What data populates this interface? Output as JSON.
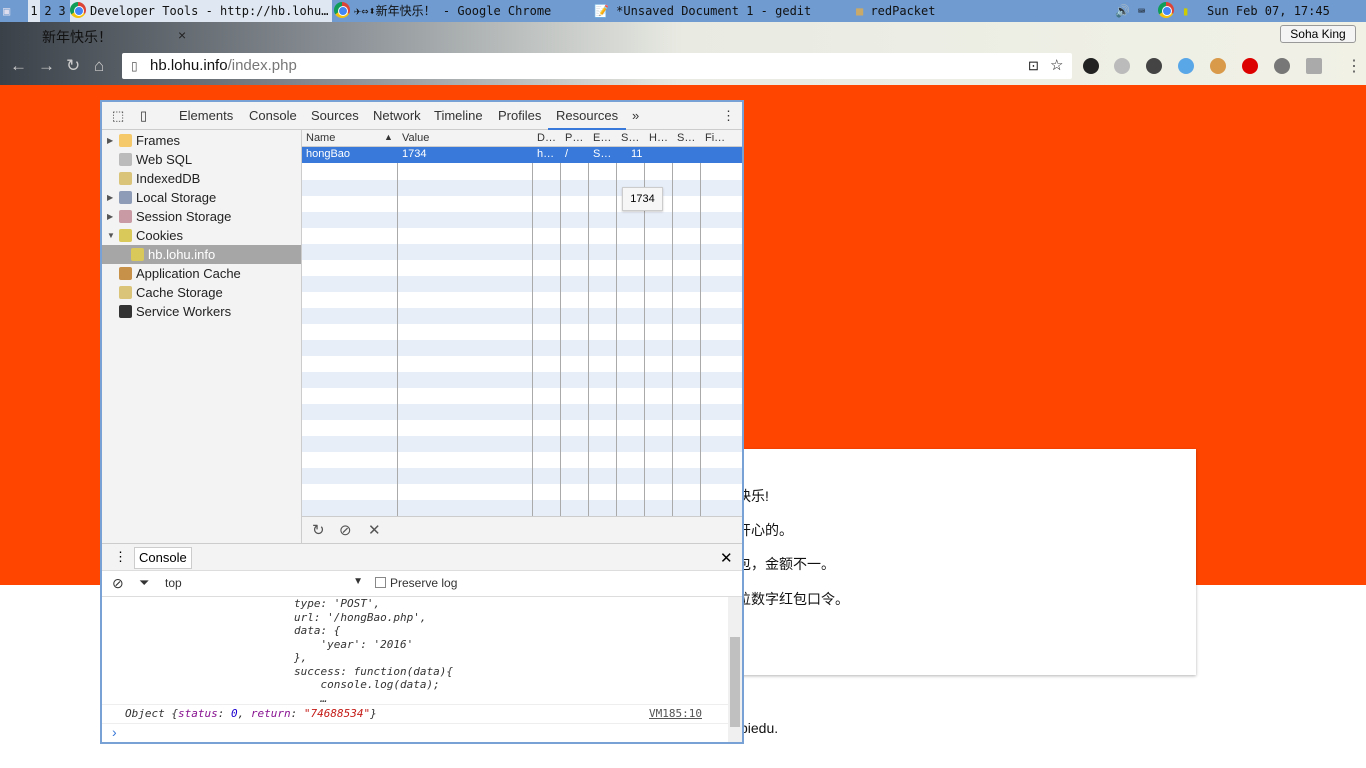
{
  "taskbar": {
    "workspaces": [
      "1",
      "2",
      "3"
    ],
    "windows": [
      "Developer Tools - http://hb.lohu…",
      "✈⇔⬍新年快乐！ - Google Chrome",
      "*Unsaved Document 1 - gedit",
      "redPacket"
    ],
    "clock": "Sun Feb 07, 17:45"
  },
  "browser": {
    "tab_title": "新年快乐！",
    "tab_close": "×",
    "user": "Soha King",
    "url_host": "hb.lohu.info",
    "url_path": "/index.php"
  },
  "page": {
    "lines": [
      "快乐!",
      "开心的。",
      "包，金额不一。",
      "位数字红包口令。"
    ],
    "footer": "piedu."
  },
  "devtools": {
    "tabs": [
      "Elements",
      "Console",
      "Sources",
      "Network",
      "Timeline",
      "Profiles",
      "Resources"
    ],
    "active_tab": "Resources",
    "more": "»",
    "tree": [
      {
        "label": "Frames",
        "arrow": "▶"
      },
      {
        "label": "Web SQL",
        "arrow": ""
      },
      {
        "label": "IndexedDB",
        "arrow": ""
      },
      {
        "label": "Local Storage",
        "arrow": "▶"
      },
      {
        "label": "Session Storage",
        "arrow": "▶"
      },
      {
        "label": "Cookies",
        "arrow": "▼"
      },
      {
        "label": "hb.lohu.info",
        "arrow": ""
      },
      {
        "label": "Application Cache",
        "arrow": ""
      },
      {
        "label": "Cache Storage",
        "arrow": ""
      },
      {
        "label": "Service Workers",
        "arrow": ""
      }
    ],
    "columns": [
      "Name",
      "Value",
      "D…",
      "P…",
      "E…",
      "S…",
      "H…",
      "S…",
      "Fi…"
    ],
    "sort_icon": "▲",
    "row": [
      "hongBao",
      "1734",
      "h…",
      "/",
      "S…",
      "11",
      "",
      "",
      ""
    ],
    "tooltip": "1734",
    "footer_icons": [
      "↻",
      "⊘",
      "✕"
    ]
  },
  "console": {
    "tab": "Console",
    "close": "✕",
    "context": "top",
    "preserve_log": "Preserve log",
    "preserve_checked": false,
    "code": [
      "type: 'POST',",
      "url: '/hongBao.php',",
      "data: {",
      "    'year': '2016'",
      "},",
      "success: function(data){",
      "    console.log(data);",
      "    …"
    ],
    "obj_prefix": "Object {",
    "status_key": "status",
    "status_val": "0",
    "return_key": "return",
    "return_val": "\"74688534\"",
    "obj_suffix": "}",
    "source": "VM185:10",
    "prompt": "›"
  }
}
